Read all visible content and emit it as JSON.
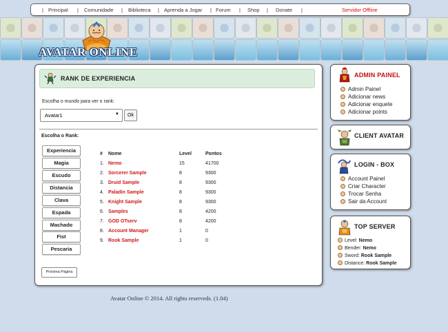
{
  "nav": {
    "links": [
      "Principal",
      "Comunidade",
      "Biblioteca",
      "Aprenda a Jogar",
      "Forum",
      "Shop",
      "Donate"
    ],
    "server_status": "Servidor Offline"
  },
  "logo": {
    "text": "AVATAR ONLINE"
  },
  "rank": {
    "title": "RANK DE EXPERIENCIA",
    "world_label": "Escolha o mundo para ver o rank:",
    "world_selected": "Avatar1",
    "ok_label": "Ok",
    "category_label": "Escolha o Rank:",
    "categories": [
      "Experiencia",
      "Magia",
      "Escudo",
      "Distancia",
      "Clava",
      "Espada",
      "Machado",
      "Fist",
      "Pescaria"
    ],
    "columns": [
      "#",
      "Nome",
      "Level",
      "Pontos"
    ],
    "rows": [
      {
        "pos": "1.",
        "name": "Nemo",
        "level": "15",
        "points": "41700"
      },
      {
        "pos": "2.",
        "name": "Sorcerer Sample",
        "level": "8",
        "points": "9300"
      },
      {
        "pos": "3.",
        "name": "Druid Sample",
        "level": "8",
        "points": "9300"
      },
      {
        "pos": "4.",
        "name": "Paladin Sample",
        "level": "8",
        "points": "9300"
      },
      {
        "pos": "5.",
        "name": "Knight Sample",
        "level": "8",
        "points": "9300"
      },
      {
        "pos": "6.",
        "name": "Samples",
        "level": "8",
        "points": "4200"
      },
      {
        "pos": "7.",
        "name": "GOD OTserv",
        "level": "8",
        "points": "4200"
      },
      {
        "pos": "8.",
        "name": "Account Manager",
        "level": "1",
        "points": "0"
      },
      {
        "pos": "9.",
        "name": "Rook Sample",
        "level": "1",
        "points": "0"
      }
    ],
    "next_label": "Próxima Página"
  },
  "footer": {
    "text": "Avatar Online © 2014. All rights reserveds. (1.04)"
  },
  "admin": {
    "title": "ADMIN PAINEL",
    "items": [
      "Admin Painel",
      "Adicionar news",
      "Adicionar enquete",
      "Adicionar points"
    ]
  },
  "client": {
    "title": "CLIENT AVATAR"
  },
  "login": {
    "title": "LOGIN - BOX",
    "items": [
      "Account Painel",
      "Criar Character",
      "Trocar Senha",
      "Sair da Account"
    ]
  },
  "top_server": {
    "title": "TOP SERVER",
    "stats": [
      {
        "label": "Level:",
        "value": "Nemo"
      },
      {
        "label": "Bender:",
        "value": "Nemo"
      },
      {
        "label": "Sword:",
        "value": "Rook Sample"
      },
      {
        "label": "Distance:",
        "value": "Rook Sample"
      }
    ]
  },
  "colors": {
    "accent_red": "#d01818",
    "header_green": "#dbeedd",
    "background": "#cfdcec"
  }
}
